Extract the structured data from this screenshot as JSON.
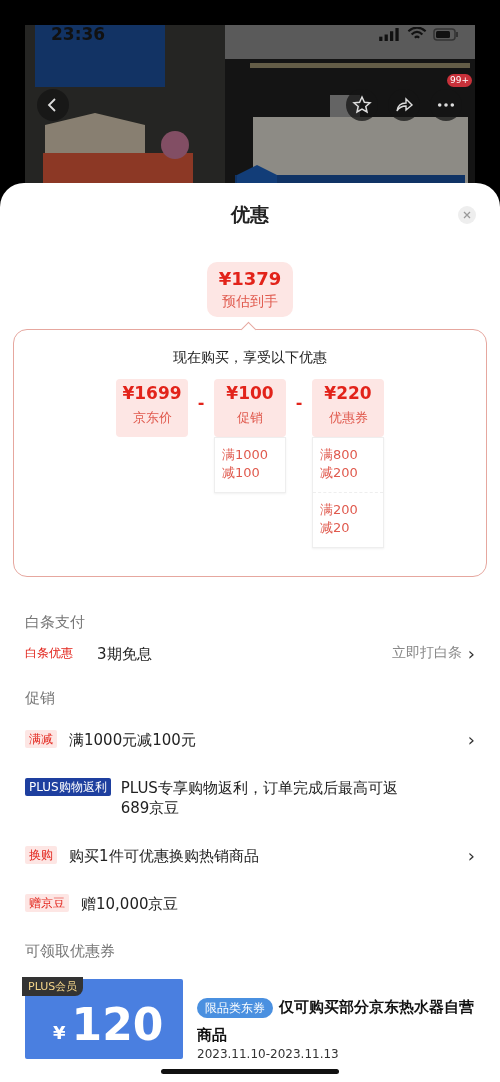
{
  "status_bar": {
    "time": "23:36"
  },
  "header": {
    "badge": "99+"
  },
  "sheet": {
    "title": "优惠"
  },
  "estimate": {
    "price": "¥1379",
    "label": "预估到手"
  },
  "breakdown": {
    "heading": "现在购买，享受以下优惠",
    "terms": [
      {
        "amount": "¥1699",
        "label": "京东价"
      },
      {
        "amount": "¥100",
        "label": "促销",
        "details": [
          "满1000\n减100"
        ]
      },
      {
        "amount": "¥220",
        "label": "优惠券",
        "details": [
          "满800\n减200",
          "满200\n减20"
        ]
      }
    ],
    "operators": [
      "-",
      "-"
    ]
  },
  "payment": {
    "title": "白条支付",
    "items": [
      {
        "kind": "plain",
        "tag": "白条优惠",
        "text": "3期免息",
        "action": "立即打白条",
        "chevron": "›"
      }
    ]
  },
  "promotions": {
    "title": "促销",
    "items": [
      {
        "kind": "pink",
        "tag": "满减",
        "text": "满1000元减100元",
        "chevron": "›"
      },
      {
        "kind": "plus",
        "tag": "PLUS购物返利",
        "text": "PLUS专享购物返利，订单完成后最高可返689京豆"
      },
      {
        "kind": "pink",
        "tag": "换购",
        "text": "购买1件可优惠换购热销商品",
        "chevron": "›"
      },
      {
        "kind": "pink",
        "tag": "赠京豆",
        "text": "赠10,000京豆"
      }
    ]
  },
  "coupons": {
    "title": "可领取优惠券",
    "items": [
      {
        "badge": "PLUS会员",
        "currency": "¥",
        "amount": "120",
        "tag": "限品类东券",
        "text": "仅可购买部分京东热水器自营商品",
        "validity": "2023.11.10-2023.11.13"
      }
    ]
  }
}
